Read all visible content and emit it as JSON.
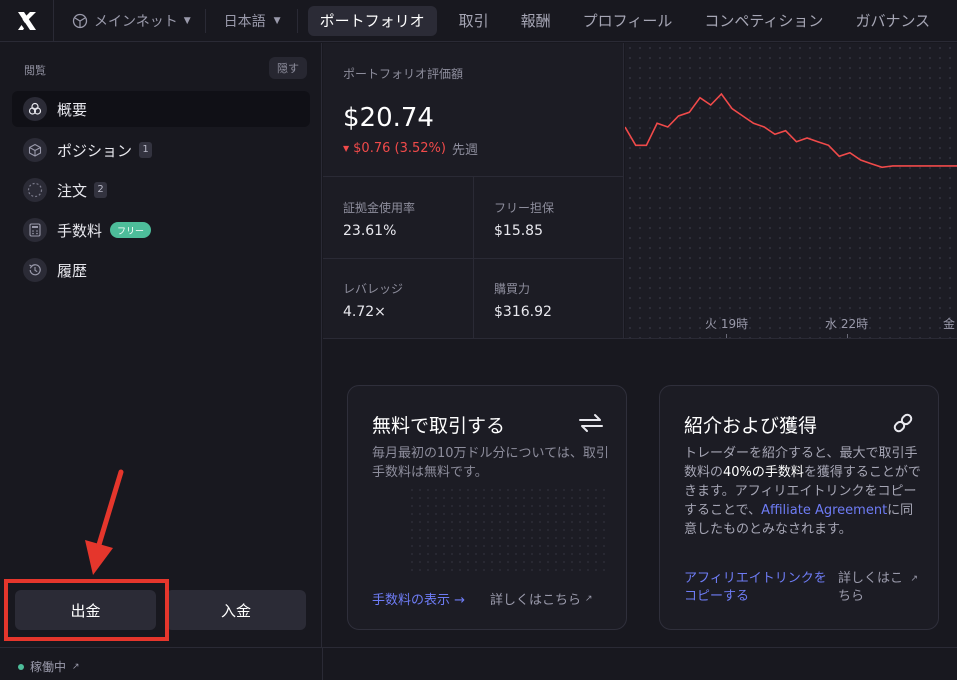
{
  "topbar": {
    "network": "メインネット",
    "language": "日本語",
    "tabs": [
      "ポートフォリオ",
      "取引",
      "報酬",
      "プロフィール",
      "コンペティション",
      "ガバナンス"
    ]
  },
  "sidebar": {
    "header": "閲覧",
    "hide_label": "隠す",
    "items": [
      {
        "label": "概要",
        "icon": "overview-icon"
      },
      {
        "label": "ポジション",
        "count": "1",
        "icon": "cube-icon"
      },
      {
        "label": "注文",
        "count": "2",
        "icon": "dashed-circle-icon"
      },
      {
        "label": "手数料",
        "badge": "フリー",
        "icon": "calculator-icon"
      },
      {
        "label": "履歴",
        "icon": "history-icon"
      }
    ],
    "withdraw_label": "出金",
    "deposit_label": "入金"
  },
  "portfolio": {
    "value_label": "ポートフォリオ評価額",
    "value": "$20.74",
    "change": "$0.76 (3.52%)",
    "change_period": "先週",
    "stats": [
      {
        "label": "証拠金使用率",
        "value": "23.61%"
      },
      {
        "label": "フリー担保",
        "value": "$15.85"
      },
      {
        "label": "レバレッジ",
        "value": "4.72×"
      },
      {
        "label": "購買力",
        "value": "$316.92"
      }
    ]
  },
  "chart_data": {
    "type": "line",
    "x_ticks": [
      "火 19時",
      "水 22時",
      "金"
    ],
    "series": [
      {
        "color": "#f04a4a",
        "values": [
          21.8,
          21.3,
          21.3,
          21.9,
          21.8,
          22.1,
          22.2,
          22.6,
          22.4,
          22.7,
          22.3,
          22.1,
          21.9,
          21.8,
          21.6,
          21.7,
          21.4,
          21.5,
          21.4,
          21.3,
          21.0,
          21.1,
          20.9,
          20.8,
          20.7,
          20.74,
          20.74,
          20.74,
          20.74,
          20.74,
          20.74,
          20.74
        ]
      }
    ]
  },
  "cards": {
    "fees": {
      "title": "無料で取引する",
      "desc": "毎月最初の10万ドル分については、取引手数料は無料です。",
      "link": "手数料の表示 →",
      "more": "詳しくはこちら"
    },
    "referral": {
      "title": "紹介および獲得",
      "desc_a": "トレーダーを紹介すると、最大で取引手数料の",
      "desc_b": "40%の手数料",
      "desc_c": "を獲得することができます。アフィリエイトリンクをコピーすることで、",
      "desc_link": "Affiliate Agreement",
      "desc_d": "に同意したものとみなされます。",
      "link": "アフィリエイトリンクをコピーする",
      "more": "詳しくはこちら"
    }
  },
  "footer": {
    "status": "稼働中"
  },
  "colors": {
    "accent": "#6e7cf5",
    "negative": "#f04a4a",
    "positive": "#4dbd9a",
    "highlight": "#e5362c"
  }
}
